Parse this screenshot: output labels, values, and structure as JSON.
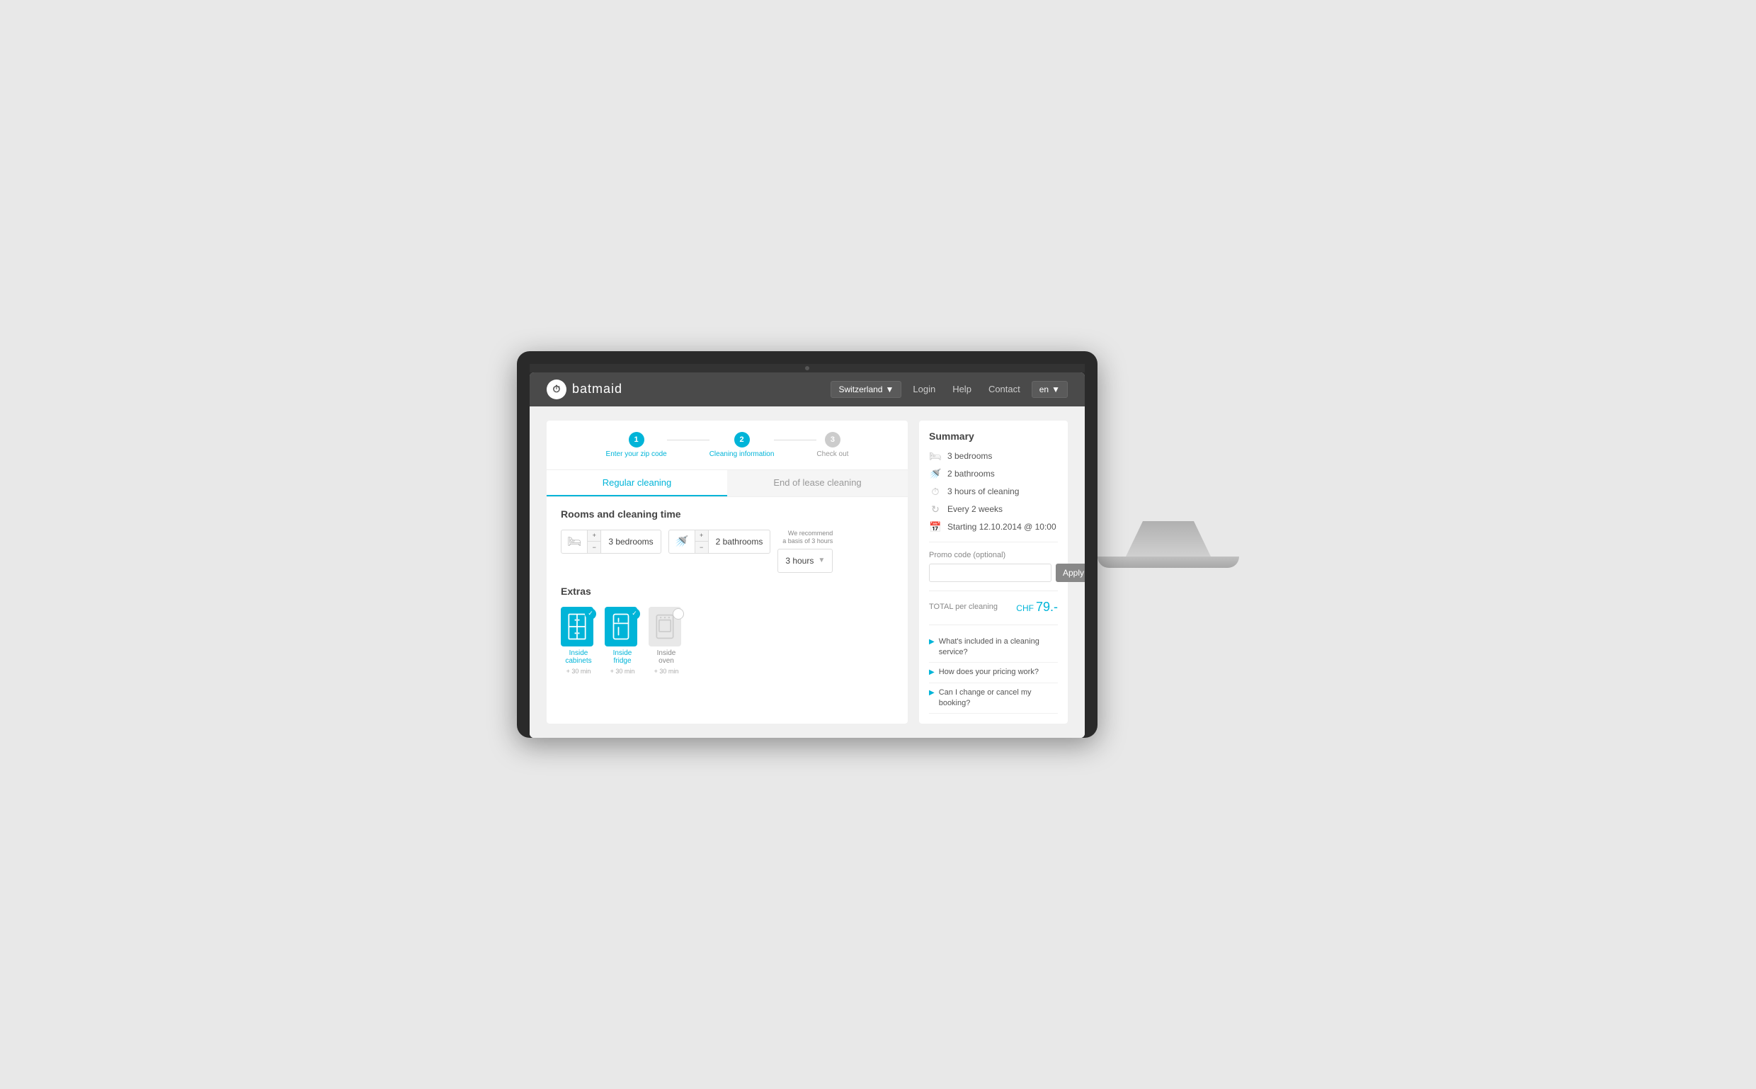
{
  "app": {
    "logo_text": "batmaid",
    "logo_symbol": "⏱"
  },
  "navbar": {
    "country": "Switzerland",
    "country_arrow": "▼",
    "login": "Login",
    "help": "Help",
    "contact": "Contact",
    "lang": "en",
    "lang_arrow": "▼"
  },
  "steps": [
    {
      "number": "1",
      "label": "Enter your zip code",
      "state": "active"
    },
    {
      "number": "2",
      "label": "Cleaning information",
      "state": "active"
    },
    {
      "number": "3",
      "label": "Check out",
      "state": "inactive"
    }
  ],
  "tabs": [
    {
      "label": "Regular cleaning",
      "state": "active"
    },
    {
      "label": "End of lease cleaning",
      "state": "inactive"
    }
  ],
  "rooms_section": {
    "title": "Rooms and cleaning time",
    "recommendation": "We recommend\na basis of 3 hours",
    "bedrooms": {
      "count": "3",
      "label": "bedrooms"
    },
    "bathrooms": {
      "count": "2",
      "label": "bathrooms"
    },
    "hours": {
      "value": "3 hours",
      "label": "hours"
    }
  },
  "extras": {
    "title": "Extras",
    "items": [
      {
        "label": "Inside cabinets",
        "sublabel": "+ 30 min",
        "selected": true,
        "icon": "🚪"
      },
      {
        "label": "Inside fridge",
        "sublabel": "+ 30 min",
        "selected": true,
        "icon": "❄"
      },
      {
        "label": "Inside oven",
        "sublabel": "+ 30 min",
        "selected": false,
        "icon": "⬜"
      }
    ]
  },
  "summary": {
    "title": "Summary",
    "items": [
      {
        "icon": "bed",
        "text": "3  bedrooms"
      },
      {
        "icon": "bath",
        "text": "2 bathrooms"
      },
      {
        "icon": "clock",
        "text": "3 hours of cleaning"
      },
      {
        "icon": "repeat",
        "text": "Every 2 weeks"
      },
      {
        "icon": "calendar",
        "text": "Starting 12.10.2014 @ 10:00"
      }
    ],
    "promo": {
      "label": "Promo code (optional)",
      "placeholder": "",
      "apply": "Apply"
    },
    "total_label": "TOTAL per cleaning",
    "currency": "CHF",
    "price": "79.-"
  },
  "faq": [
    {
      "text": "What's included in a cleaning service?"
    },
    {
      "text": "How does your pricing work?"
    },
    {
      "text": "Can I change or cancel my booking?"
    }
  ]
}
